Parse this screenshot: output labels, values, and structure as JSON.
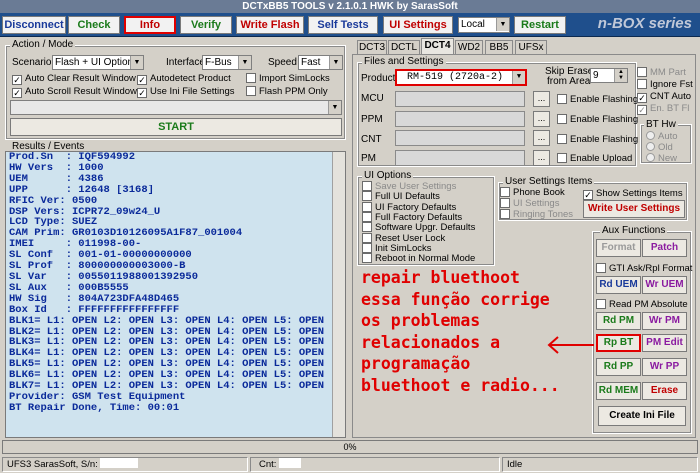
{
  "window": {
    "title": "DCTxBB5 TOOLS v 2.1.0.1 HWK by SarasSoft"
  },
  "toolbar": {
    "disconnect": "Disconnect",
    "check": "Check",
    "info": "Info",
    "verify": "Verify",
    "write_flash": "Write Flash",
    "self_tests": "Self Tests",
    "ui_settings": "UI Settings",
    "local_value": "Local",
    "restart": "Restart",
    "brand": "n-BOX series"
  },
  "action": {
    "group_label": "Action / Mode",
    "scenario_label": "Scenario",
    "scenario_value": "Flash + UI Options",
    "interface_label": "Interface",
    "interface_value": "F-Bus",
    "speed_label": "Speed",
    "speed_value": "Fast",
    "checks": [
      {
        "label": "Auto Clear Result Window",
        "checked": true
      },
      {
        "label": "Autodetect Product",
        "checked": true
      },
      {
        "label": "Import SimLocks",
        "checked": false
      },
      {
        "label": "Auto Scroll Result Window",
        "checked": true
      },
      {
        "label": "Use Ini File Settings",
        "checked": true
      },
      {
        "label": "Flash PPM Only",
        "checked": false
      }
    ],
    "start": "START"
  },
  "results": {
    "group_label": "Results / Events",
    "lines": [
      "Prod.Sn  : IQF594992",
      "HW Vers  : 1000",
      "UEM      : 4386",
      "UPP      : 12648 [3168]",
      "RFIC Ver: 0500",
      "DSP Vers: ICPR72_09w24_U",
      "LCD Type: SUEZ",
      "CAM Prim: GR0103D10126095A1F87_001004",
      "IMEI     : 011998-00-",
      "SL Conf  : 001-01-00000000000",
      "SL Prof  : 800000000003000-B",
      "SL Var   : 0055011988001392950",
      "SL Aux   : 000B5555",
      "HW Sig   : 804A723DFA48D465",
      "Box Id   : FFFFFFFFFFFFFFFF",
      "BLK1= L1: OPEN L2: OPEN L3: OPEN L4: OPEN L5: OPEN",
      "BLK2= L1: OPEN L2: OPEN L3: OPEN L4: OPEN L5: OPEN",
      "BLK3= L1: OPEN L2: OPEN L3: OPEN L4: OPEN L5: OPEN",
      "BLK4= L1: OPEN L2: OPEN L3: OPEN L4: OPEN L5: OPEN",
      "BLK5= L1: OPEN L2: OPEN L3: OPEN L4: OPEN L5: OPEN",
      "BLK6= L1: OPEN L2: OPEN L3: OPEN L4: OPEN L5: OPEN",
      "BLK7= L1: OPEN L2: OPEN L3: OPEN L4: OPEN L5: OPEN",
      "Provider: GSM Test Equipment",
      "BT Repair Done, Time: 00:01"
    ]
  },
  "tabs": [
    "DCT3",
    "DCTL",
    "DCT4",
    "WD2",
    "BB5",
    "UFSx"
  ],
  "files": {
    "group_label": "Files and Settings",
    "product_label": "Product",
    "product_value": "RM-519 (2720a-2)",
    "skip_label_1": "Skip Erase",
    "skip_label_2": "from Area",
    "skip_value": "9",
    "rows": [
      {
        "label": "MCU",
        "enable": "Enable Flashing"
      },
      {
        "label": "PPM",
        "enable": "Enable Flashing"
      },
      {
        "label": "CNT",
        "enable": "Enable Flashing"
      },
      {
        "label": "PM",
        "enable": "Enable Upload"
      }
    ],
    "mm_part": "MM Part",
    "ignore_fst": "Ignore Fst",
    "cnt_auto": "CNT Auto",
    "en_bt_fl": "En. BT Fl",
    "bt_hw_label": "BT Hw",
    "bt_auto": "Auto",
    "bt_old": "Old",
    "bt_new": "New"
  },
  "ui_options": {
    "group_label": "UI Options",
    "items": [
      {
        "label": "Save User Settings",
        "disabled": true
      },
      {
        "label": "Full UI Defaults",
        "disabled": false
      },
      {
        "label": "UI Factory Defaults",
        "disabled": false
      },
      {
        "label": "Full Factory Defaults",
        "disabled": false
      },
      {
        "label": "Software Upgr. Defaults",
        "disabled": false
      },
      {
        "label": "Reset User Lock",
        "disabled": false
      },
      {
        "label": "Init SimLocks",
        "disabled": false
      },
      {
        "label": "Reboot in Normal Mode",
        "disabled": false
      }
    ]
  },
  "user_settings": {
    "group_label": "User Settings Items",
    "phone_book": "Phone Book",
    "ui_settings": "UI Settings",
    "ringing_tones": "Ringing Tones",
    "show_settings": "Show Settings Items",
    "write_btn": "Write User Settings"
  },
  "aux": {
    "group_label": "Aux Functions",
    "format": "Format",
    "patch": "Patch",
    "gti": "GTI Ask/Rpl Format",
    "rd_uem": "Rd UEM",
    "wr_uem": "Wr UEM",
    "read_pm_absolute": "Read PM Absolute",
    "rd_pm": "Rd PM",
    "wr_pm": "Wr PM",
    "rp_bt": "Rp BT",
    "pm_edit": "PM Edit",
    "rd_pp": "Rd PP",
    "wr_pp": "Wr PP",
    "rd_mem": "Rd MEM",
    "erase": "Erase",
    "create_ini": "Create Ini File"
  },
  "annotation": {
    "text": "repair bluethoot\nessa função corrige\nos problemas\nrelacionados a\nprogramação\nbluethoot e radio..."
  },
  "status": {
    "progress": "0%",
    "progress_value": 0,
    "sn_label": "UFS3 SarasSoft, S/n:",
    "cnt_label": "Cnt:",
    "state": "Idle"
  },
  "colors": {
    "toolbar_bg": "#1f4f8c",
    "results_bg": "#cfe3ee",
    "results_text": "#0a2a9a",
    "highlight": "#e00000"
  }
}
